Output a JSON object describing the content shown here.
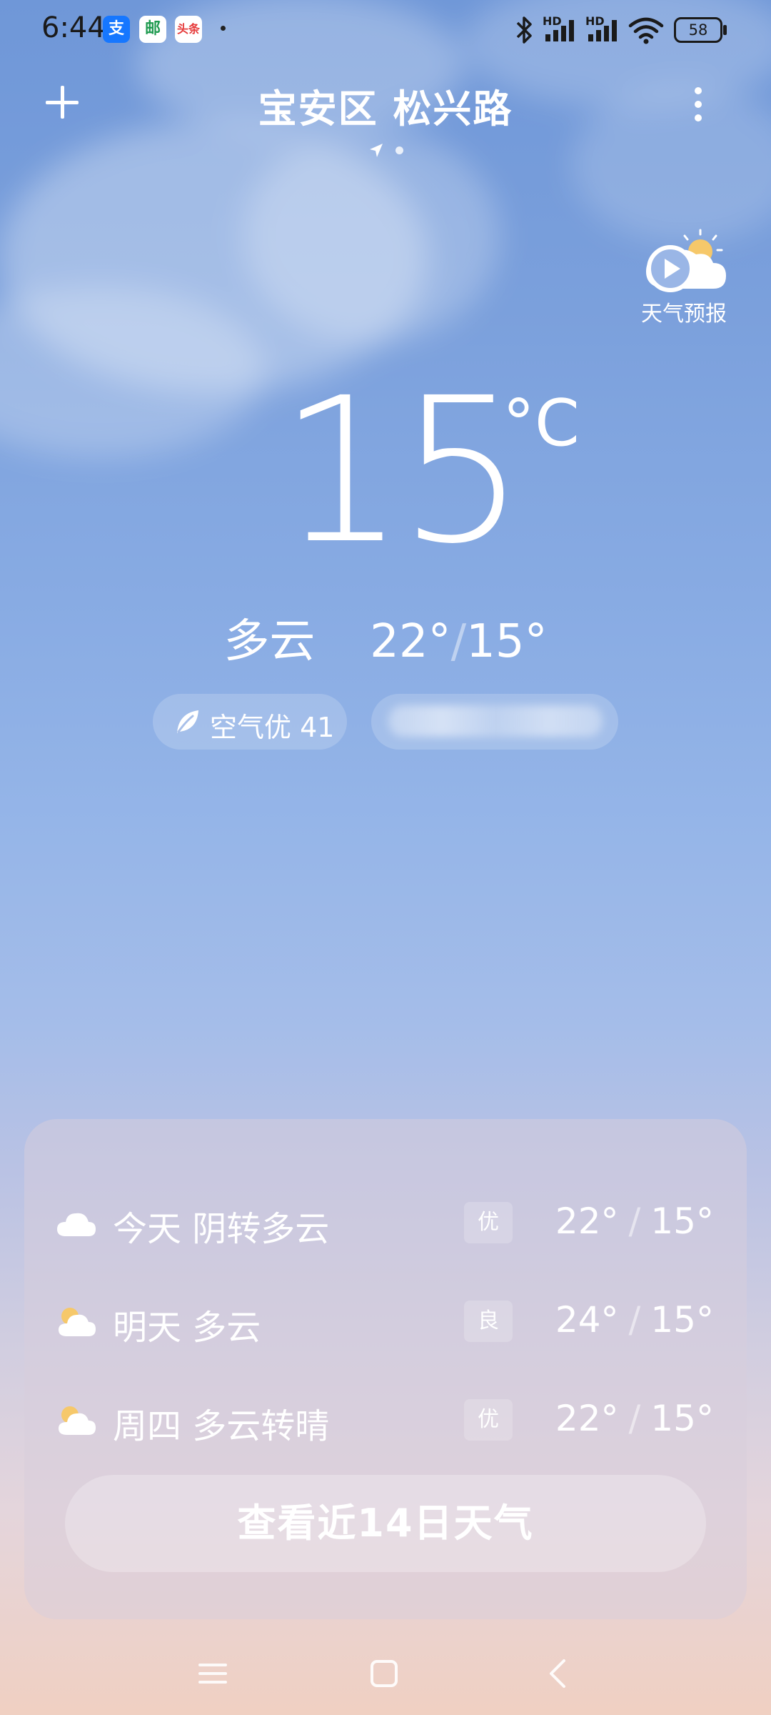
{
  "status_bar": {
    "time": "6:44",
    "app_icons": [
      {
        "name": "alipay-icon",
        "glyph": "支",
        "bg": "#1677ff"
      },
      {
        "name": "post-office-icon",
        "glyph": "邮",
        "bg": "#1e9a4f"
      },
      {
        "name": "toutiao-icon",
        "glyph": "头条",
        "bg": "#e63b3b"
      }
    ],
    "signal_1_label": "HD",
    "signal_2_label": "HD",
    "battery": "58"
  },
  "header": {
    "location": "宝安区 松兴路"
  },
  "forecast_video": {
    "label": "天气预报"
  },
  "current": {
    "temperature": "15",
    "unit": "°C",
    "condition": "多云",
    "high": "22°",
    "low": "15°",
    "separator": "/"
  },
  "aqi": {
    "label": "空气优 41"
  },
  "daily": [
    {
      "day": "今天",
      "condition": "阴转多云",
      "quality": "优",
      "high": "22°",
      "low": "15°",
      "icon": "cloud-icon"
    },
    {
      "day": "明天",
      "condition": "多云",
      "quality": "良",
      "high": "24°",
      "low": "15°",
      "icon": "partly-cloudy-icon"
    },
    {
      "day": "周四",
      "condition": "多云转晴",
      "quality": "优",
      "high": "22°",
      "low": "15°",
      "icon": "partly-cloudy-icon"
    }
  ],
  "separator": "/",
  "more_days_button": "查看近14日天气",
  "colors": {
    "sky_top": "#6f97d8",
    "sky_bottom": "#f0d0c2",
    "sun": "#f6c86a"
  }
}
